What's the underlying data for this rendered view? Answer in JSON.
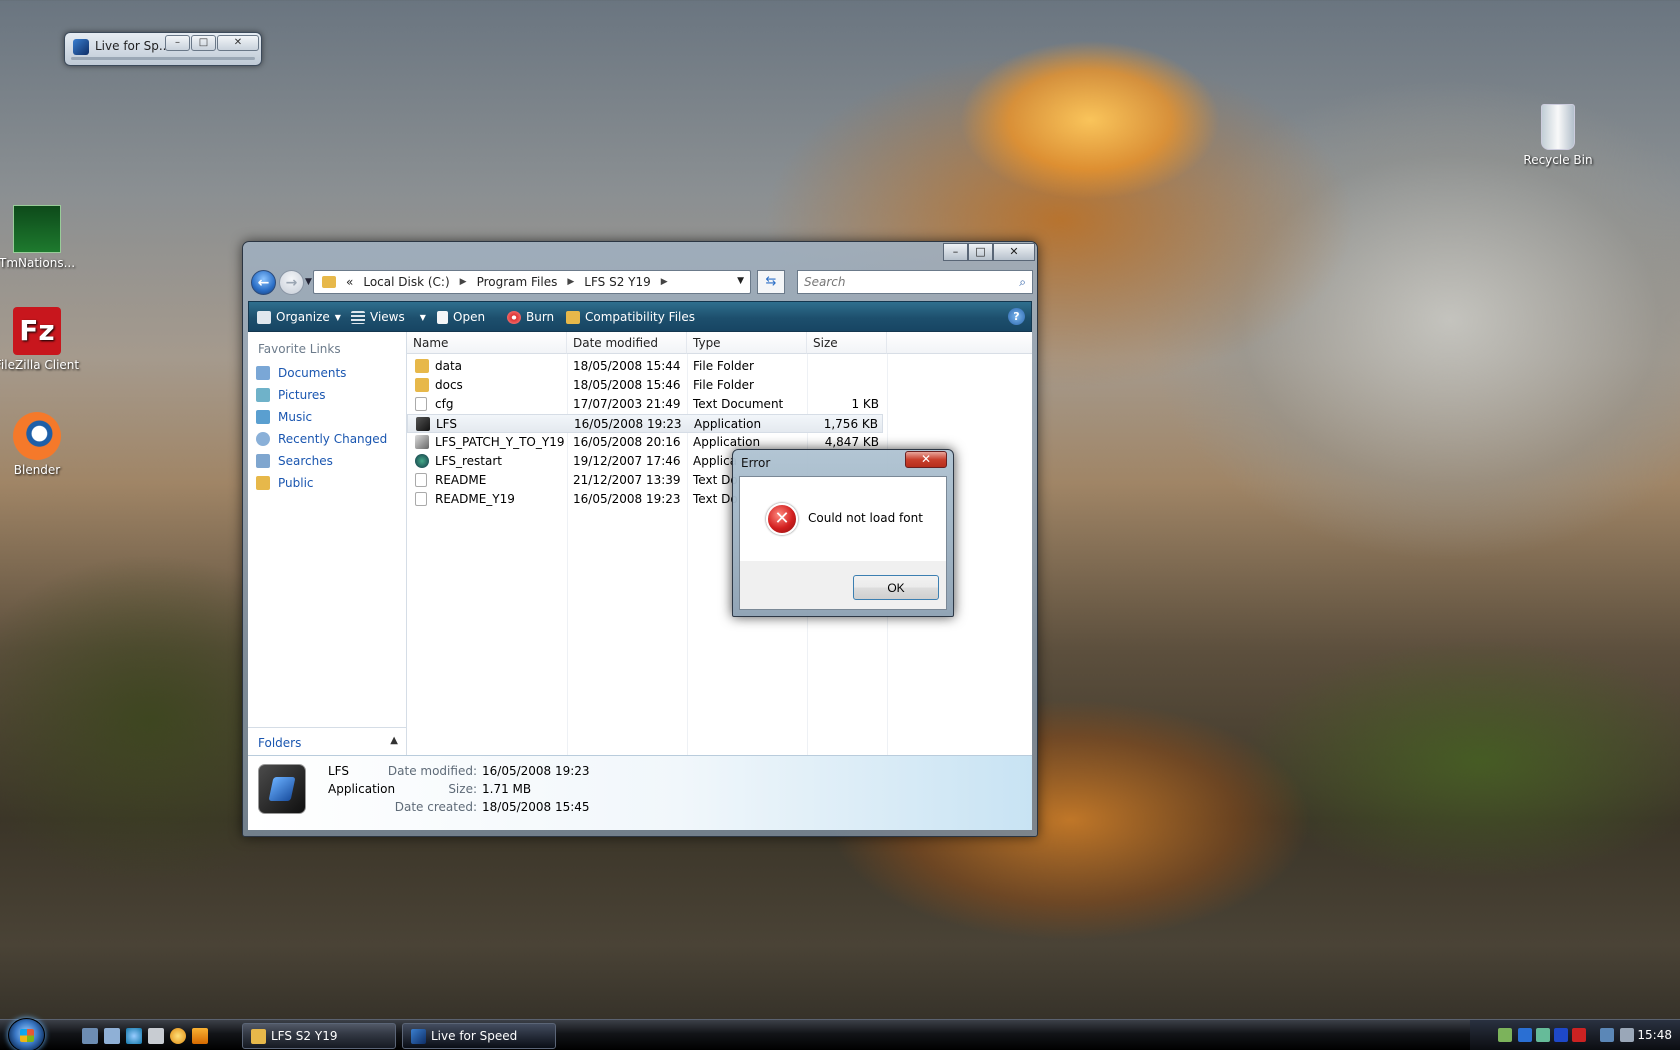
{
  "desktop": {
    "icons": [
      {
        "label": "TmNations...",
        "icon": "tmnations-shortcut-icon"
      },
      {
        "label": "FileZilla Client",
        "icon": "filezilla-shortcut-icon"
      },
      {
        "label": "Blender",
        "icon": "blender-shortcut-icon"
      },
      {
        "label": "Recycle Bin",
        "icon": "recycle-bin-icon"
      }
    ]
  },
  "mini_window": {
    "title": "Live for Sp...",
    "min": "–",
    "max": "□",
    "close": "✕"
  },
  "explorer": {
    "controls": {
      "min": "–",
      "max": "□",
      "close": "✕"
    },
    "breadcrumb": [
      "«",
      "Local Disk (C:)",
      "Program Files",
      "LFS S2 Y19"
    ],
    "search_placeholder": "Search",
    "toolbar": {
      "organize": "Organize",
      "views": "Views",
      "open": "Open",
      "burn": "Burn",
      "compat": "Compatibility Files",
      "help": "?"
    },
    "favorite_links": {
      "heading": "Favorite Links",
      "items": [
        "Documents",
        "Pictures",
        "Music",
        "Recently Changed",
        "Searches",
        "Public"
      ]
    },
    "folders_label": "Folders",
    "columns": [
      "Name",
      "Date modified",
      "Type",
      "Size"
    ],
    "files": [
      {
        "name": "data",
        "date": "18/05/2008 15:44",
        "type": "File Folder",
        "size": ""
      },
      {
        "name": "docs",
        "date": "18/05/2008 15:46",
        "type": "File Folder",
        "size": ""
      },
      {
        "name": "cfg",
        "date": "17/07/2003 21:49",
        "type": "Text Document",
        "size": "1 KB"
      },
      {
        "name": "LFS",
        "date": "16/05/2008 19:23",
        "type": "Application",
        "size": "1,756 KB"
      },
      {
        "name": "LFS_PATCH_Y_TO_Y19",
        "date": "16/05/2008 20:16",
        "type": "Application",
        "size": "4,847 KB"
      },
      {
        "name": "LFS_restart",
        "date": "19/12/2007 17:46",
        "type": "Applica",
        "size": ""
      },
      {
        "name": "README",
        "date": "21/12/2007 13:39",
        "type": "Text Do",
        "size": ""
      },
      {
        "name": "README_Y19",
        "date": "16/05/2008 19:23",
        "type": "Text Do",
        "size": ""
      }
    ],
    "details": {
      "name": "LFS",
      "kind": "Application",
      "modified_label": "Date modified:",
      "modified": "16/05/2008 19:23",
      "size_label": "Size:",
      "size": "1.71 MB",
      "created_label": "Date created:",
      "created": "18/05/2008 15:45"
    }
  },
  "dialog": {
    "title": "Error",
    "close": "✕",
    "message": "Could not load font",
    "ok": "OK"
  },
  "taskbar": {
    "tasks": [
      {
        "label": "LFS S2 Y19"
      },
      {
        "label": "Live for Speed"
      }
    ],
    "clock": "15:48"
  }
}
